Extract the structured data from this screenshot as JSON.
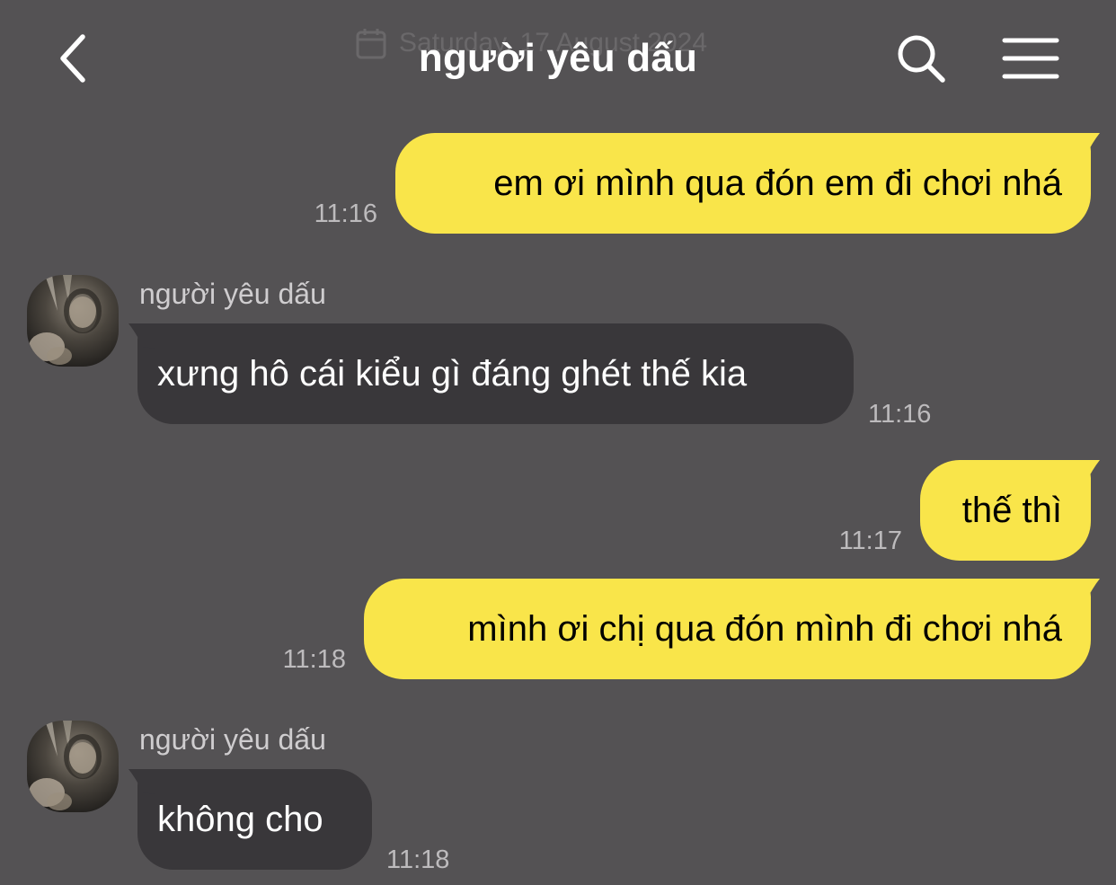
{
  "header": {
    "title": "người yêu dấu",
    "date_overlay": "Saturday, 17 August 2024"
  },
  "colors": {
    "background": "#545254",
    "outgoing_bubble": "#f9e54a",
    "incoming_bubble": "#39373a"
  },
  "messages": [
    {
      "direction": "out",
      "text": "em ơi mình qua đón em đi chơi nhá",
      "time": "11:16"
    },
    {
      "direction": "in",
      "sender": "người yêu dấu",
      "text": "xưng hô cái kiểu gì đáng ghét thế kia",
      "time": "11:16"
    },
    {
      "direction": "out",
      "text": "thế thì",
      "time": "11:17"
    },
    {
      "direction": "out",
      "text": "mình ơi chị qua đón mình đi chơi nhá",
      "time": "11:18"
    },
    {
      "direction": "in",
      "sender": "người yêu dấu",
      "text": "không cho",
      "time": "11:18"
    }
  ],
  "icons": {
    "back": "chevron-left-icon",
    "search": "search-icon",
    "menu": "hamburger-menu-icon",
    "date": "calendar-icon"
  }
}
